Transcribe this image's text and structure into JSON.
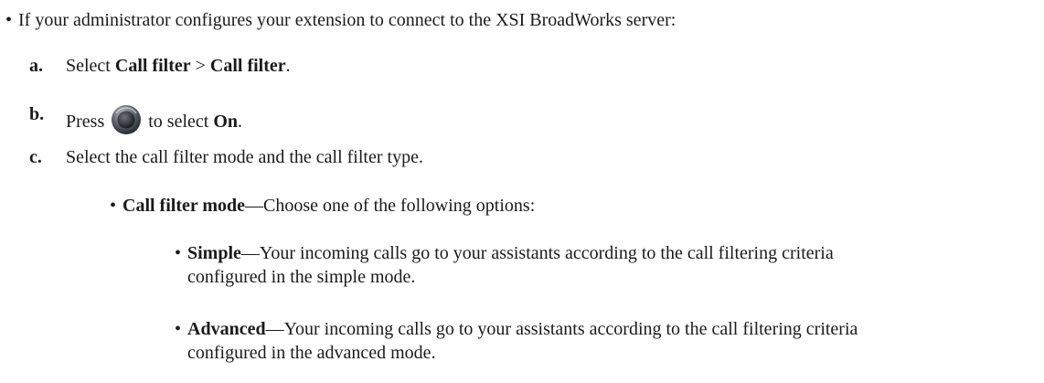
{
  "intro": {
    "bullet": "•",
    "text": "If your administrator configures your extension to connect to the XSI BroadWorks server:"
  },
  "steps": [
    {
      "letter": "a.",
      "pre": "Select ",
      "bold1": "Call filter",
      "mid": " > ",
      "bold2": "Call filter",
      "post": "."
    },
    {
      "letter": "b.",
      "pre": "Press ",
      "icon": "navigation-cluster-icon",
      "mid": " to select ",
      "bold": "On",
      "post": "."
    },
    {
      "letter": "c.",
      "text": "Select the call filter mode and the call filter type."
    }
  ],
  "sub_bullet": {
    "bullet": "•",
    "bold": "Call filter mode",
    "text": "—Choose one of the following options:"
  },
  "options": [
    {
      "bullet": "•",
      "bold": "Simple",
      "line1": "—Your incoming calls go to your assistants according to the call filtering criteria",
      "line2": "configured in the simple mode."
    },
    {
      "bullet": "•",
      "bold": "Advanced",
      "line1": "—Your incoming calls go to your assistants according to the call filtering criteria",
      "line2": "configured in the advanced mode."
    }
  ]
}
